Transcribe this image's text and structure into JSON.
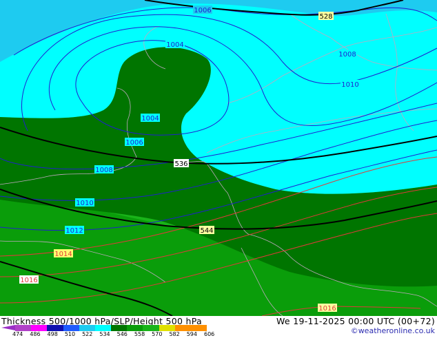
{
  "map": {
    "contours_slp": [
      {
        "label": "1006"
      },
      {
        "label": "1004"
      },
      {
        "label": "1004"
      },
      {
        "label": "1006"
      },
      {
        "label": "1008"
      },
      {
        "label": "1008"
      },
      {
        "label": "1010"
      },
      {
        "label": "1010"
      },
      {
        "label": "1012"
      },
      {
        "label": "1014"
      },
      {
        "label": "1016"
      },
      {
        "label": "1016"
      }
    ],
    "contours_height": [
      {
        "label": "528"
      },
      {
        "label": "536"
      },
      {
        "label": "544"
      }
    ],
    "colors": {
      "cyan_light": "#1ecbf0",
      "cyan": "#00ffff",
      "green_dark": "#007500",
      "green_mid": "#0a9d0a",
      "green_light": "#19b419",
      "isobar_blue": "#1f1fd0",
      "isobar_red": "#e03a3a",
      "height_black": "#000000",
      "coast": "#c0a8c0"
    }
  },
  "footer": {
    "title": "Thickness 500/1000 hPa/SLP/Height 500 hPa",
    "datetime": "We 19-11-2025 00:00 UTC (00+72)",
    "credit": "©weatheronline.co.uk",
    "scale": {
      "ticks": [
        "474",
        "486",
        "498",
        "510",
        "522",
        "534",
        "546",
        "558",
        "570",
        "582",
        "594",
        "606"
      ],
      "colors": [
        "#b040c8",
        "#ff00ff",
        "#1010b0",
        "#1e5aff",
        "#1ecbf0",
        "#00ffff",
        "#007500",
        "#0a9d0a",
        "#19b419",
        "#e0e000",
        "#ff9000",
        "#ff9000"
      ]
    }
  }
}
